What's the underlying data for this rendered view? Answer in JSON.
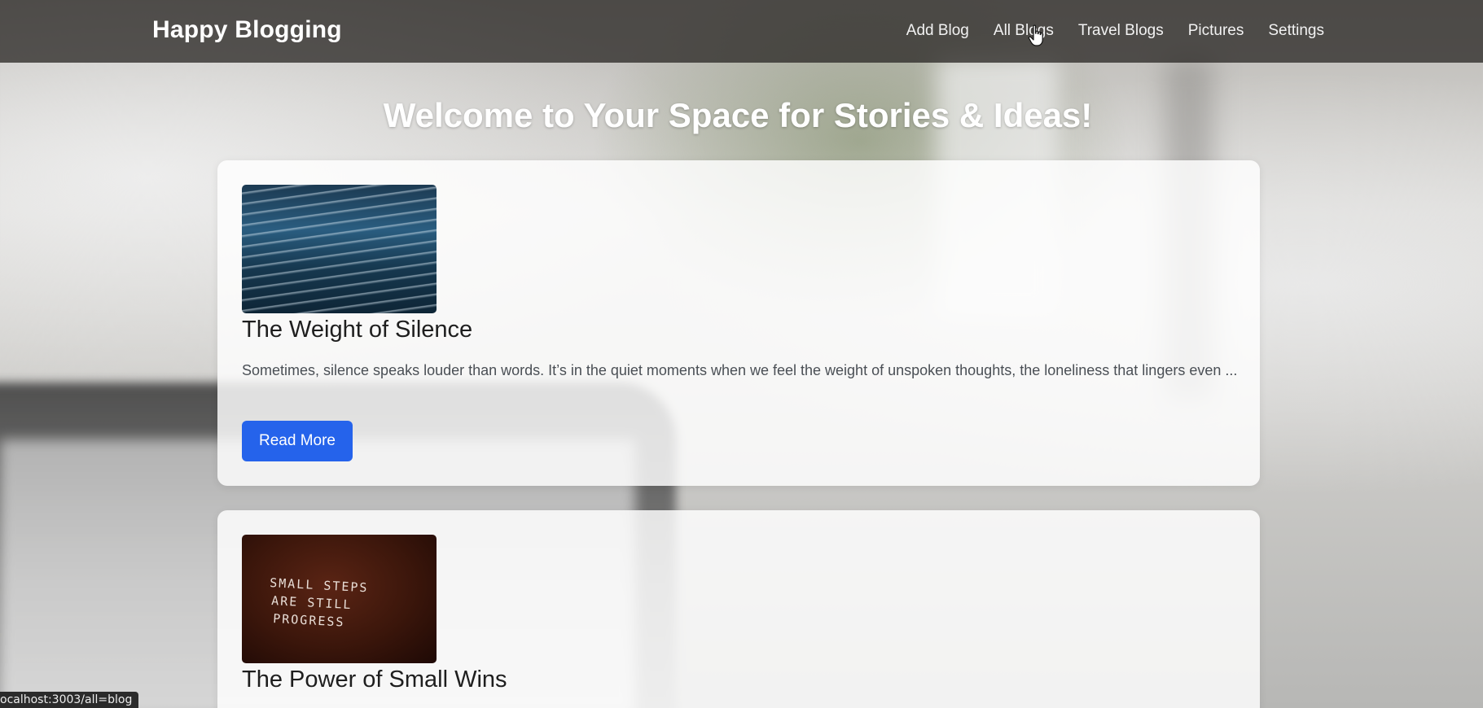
{
  "navbar": {
    "brand": "Happy Blogging",
    "links": [
      "Add Blog",
      "All Blogs",
      "Travel Blogs",
      "Pictures",
      "Settings"
    ]
  },
  "main": {
    "title": "Welcome to Your Space for Stories & Ideas!"
  },
  "blogs": [
    {
      "title": "The Weight of Silence",
      "excerpt": "Sometimes, silence speaks louder than words. It’s in the quiet moments when we feel the weight of unspoken thoughts, the loneliness that lingers even ...",
      "button_label": "Read More",
      "image_icon": "ocean-waves-image"
    },
    {
      "title": "The Power of Small Wins",
      "image_icon": "chalkboard-image",
      "image_text": [
        "SMALL STEPS",
        "ARE STILL",
        "PROGRESS"
      ]
    }
  ],
  "status_bar": {
    "url": "ocalhost:3003/all=blog"
  },
  "colors": {
    "accent": "#2563eb",
    "navbar_bg": "#2d2a28"
  }
}
